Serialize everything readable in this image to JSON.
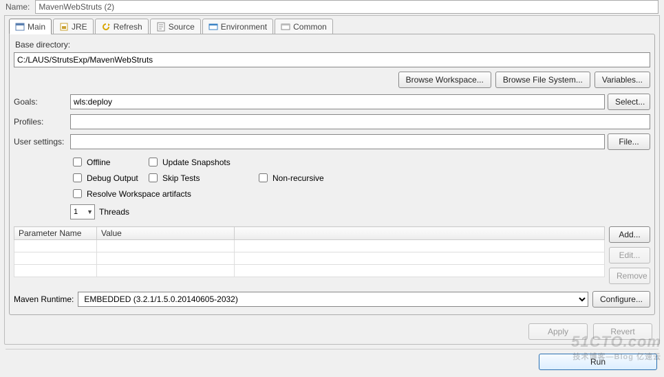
{
  "header": {
    "name_label": "Name:",
    "name_value": "MavenWebStruts (2)"
  },
  "tabs": [
    {
      "label": "Main"
    },
    {
      "label": "JRE"
    },
    {
      "label": "Refresh"
    },
    {
      "label": "Source"
    },
    {
      "label": "Environment"
    },
    {
      "label": "Common"
    }
  ],
  "main": {
    "base_dir_label": "Base directory:",
    "base_dir_value": "C:/LAUS/StrutsExp/MavenWebStruts",
    "browse_workspace": "Browse Workspace...",
    "browse_fs": "Browse File System...",
    "variables": "Variables...",
    "goals_label": "Goals:",
    "goals_value": "wls:deploy",
    "select_btn": "Select...",
    "profiles_label": "Profiles:",
    "profiles_value": "",
    "user_settings_label": "User settings:",
    "user_settings_value": "",
    "file_btn": "File...",
    "checks": {
      "offline": "Offline",
      "update_snapshots": "Update Snapshots",
      "debug_output": "Debug Output",
      "skip_tests": "Skip Tests",
      "non_recursive": "Non-recursive",
      "resolve_workspace": "Resolve Workspace artifacts"
    },
    "threads_value": "1",
    "threads_label": "Threads",
    "param_table": {
      "col_name": "Parameter Name",
      "col_value": "Value"
    },
    "param_buttons": {
      "add": "Add...",
      "edit": "Edit...",
      "remove": "Remove"
    },
    "runtime_label": "Maven Runtime:",
    "runtime_value": "EMBEDDED (3.2.1/1.5.0.20140605-2032)",
    "configure": "Configure..."
  },
  "footer": {
    "apply": "Apply",
    "revert": "Revert",
    "run": "Run"
  },
  "watermark": {
    "big": "51CTO.com",
    "small": "技术博客—Blog  亿速云"
  }
}
